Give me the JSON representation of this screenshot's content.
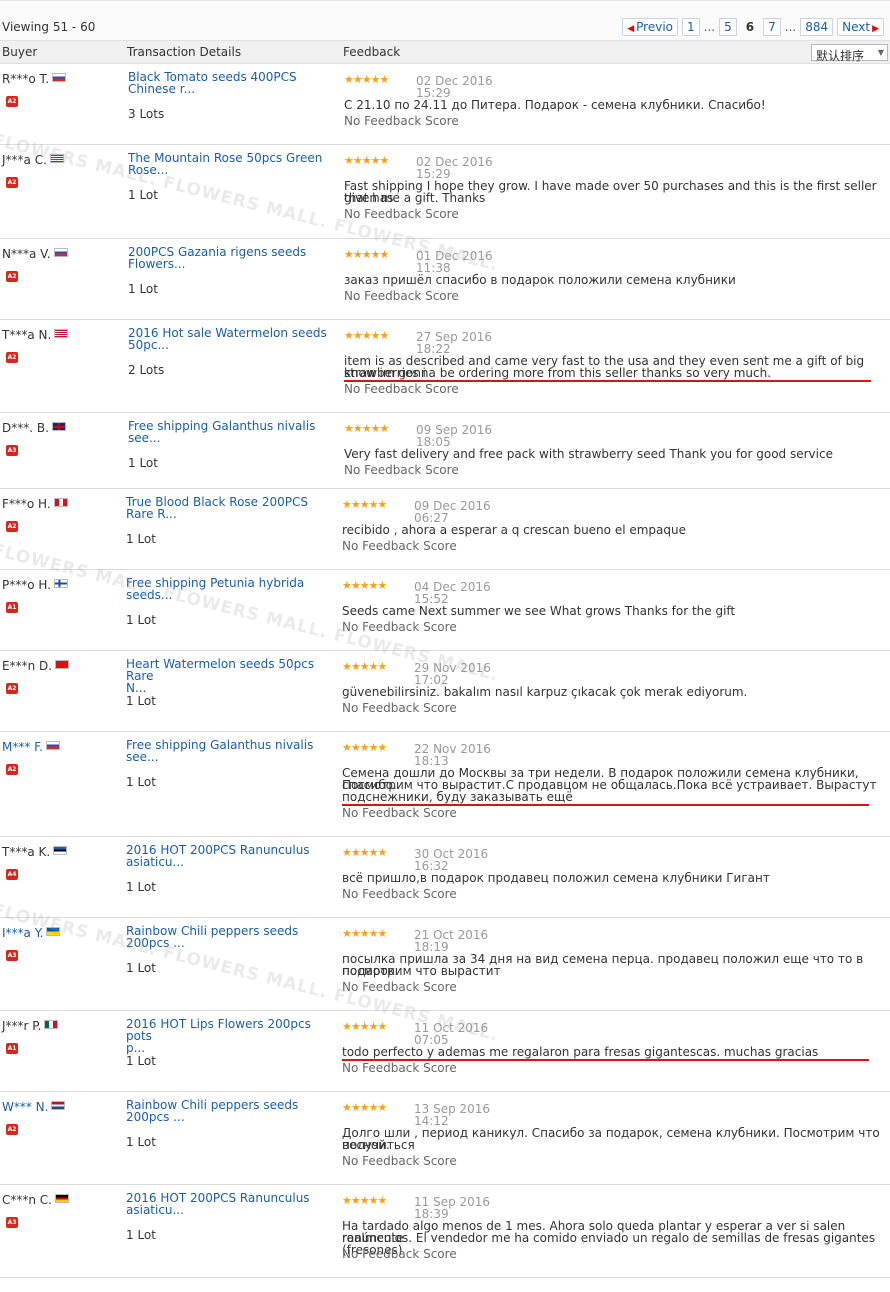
{
  "pagination": {
    "viewing": "Viewing 51 - 60",
    "prev": "Previo",
    "next": "Next",
    "pages": [
      "1",
      "...",
      "5",
      "6",
      "7",
      "...",
      "884"
    ],
    "current": "6"
  },
  "header": {
    "buyer": "Buyer",
    "transaction": "Transaction Details",
    "feedback": "Feedback",
    "sort": "默认排序"
  },
  "watermark_text": "FLOWERS MALL. FLOWERS MALL. FLOWERS MALL.",
  "colors": {
    "link": "#1a5ea8",
    "star": "#f7a11a",
    "badge": "#d9261c",
    "underline": "#e01010"
  },
  "reviews": [
    {
      "buyer": "R***o T.",
      "country": "ru",
      "level": "A2",
      "product": [
        "Black Tomato seeds 400PCS",
        "Chinese r..."
      ],
      "lots": "3 Lots",
      "stars": "★★★★★",
      "date": "02 Dec 2016",
      "time": "15:29",
      "text": [
        "С 21.10 по 24.11 до Питера. Подарок - семена клубники. Спасибо!"
      ],
      "score": "No Feedback Score"
    },
    {
      "buyer": "J***a C.",
      "country": "us",
      "level": "A2",
      "product": [
        "The Mountain Rose 50pcs Green",
        "Rose..."
      ],
      "lots": "1 Lot",
      "stars": "★★★★★",
      "date": "02 Dec 2016",
      "time": "15:29",
      "text": [
        "Fast shipping I hope they grow. I have made over 50 purchases and this is the first seller that has",
        "given me a gift. Thanks"
      ],
      "score": "No Feedback Score"
    },
    {
      "buyer": "N***a V.",
      "country": "ru",
      "level": "A2",
      "product": [
        "200PCS Gazania rigens seeds",
        "Flowers..."
      ],
      "lots": "1 Lot",
      "stars": "★★★★★",
      "date": "01 Dec 2016",
      "time": "11:38",
      "text": [
        "заказ пришёл спасибо в подарок положили семена клубники"
      ],
      "score": "No Feedback Score"
    },
    {
      "buyer": "T***a N.",
      "country": "us",
      "level": "A2",
      "product": [
        "2016 Hot sale Watermelon seeds",
        "50pc..."
      ],
      "lots": "2 Lots",
      "stars": "★★★★★",
      "date": "27 Sep 2016",
      "time": "18:22",
      "text": [
        "item is as described and came very fast to the usa and they even sent me a gift of big strawberries i",
        "know im gonna be ordering more from this seller thanks so very much."
      ],
      "score": "No Feedback Score"
    },
    {
      "buyer": "D***. B.",
      "country": "gb",
      "level": "A3",
      "product": [
        "Free shipping Galanthus nivalis",
        "see..."
      ],
      "lots": "1 Lot",
      "stars": "★★★★★",
      "date": "09 Sep 2016",
      "time": "18:05",
      "text": [
        "Very fast delivery and free pack with strawberry seed Thank you for good service"
      ],
      "score": "No Feedback Score"
    },
    {
      "buyer": "F***o H.",
      "country": "pe",
      "level": "A2",
      "product": [
        "True Blood Black Rose 200PCS",
        "Rare R..."
      ],
      "lots": "1 Lot",
      "stars": "★★★★★",
      "date": "09 Dec 2016",
      "time": "06:27",
      "text": [
        "recibido , ahora a esperar a q crescan bueno el empaque"
      ],
      "score": "No Feedback Score"
    },
    {
      "buyer": "P***o H.",
      "country": "fi",
      "level": "A1",
      "product": [
        "Free shipping Petunia hybrida",
        "seeds..."
      ],
      "lots": "1 Lot",
      "stars": "★★★★★",
      "date": "04 Dec 2016",
      "time": "15:52",
      "text": [
        "Seeds came Next summer we see What grows Thanks for the gift"
      ],
      "score": "No Feedback Score"
    },
    {
      "buyer": "E***n D.",
      "country": "tr",
      "level": "A2",
      "product": [
        "Heart Watermelon seeds 50pcs Rare",
        "N..."
      ],
      "lots": "1 Lot",
      "stars": "★★★★★",
      "date": "29 Nov 2016",
      "time": "17:02",
      "text": [
        "güvenebilirsiniz. bakalım nasıl karpuz çıkacak çok merak ediyorum."
      ],
      "score": "No Feedback Score"
    },
    {
      "buyer": "M*** F.",
      "country": "ru",
      "level": "A2",
      "product": [
        "Free shipping Galanthus nivalis",
        "see..."
      ],
      "lots": "1 Lot",
      "stars": "★★★★★",
      "date": "22 Nov 2016",
      "time": "18:13",
      "text": [
        "Семена дошли до Москвы за три недели. В подарок положили семена клубники, спасибо.",
        "Посмотрим что вырастит.С продавцом не общалась.Пока всё устраивает. Вырастут",
        "подснежники, буду заказывать ещё"
      ],
      "score": "No Feedback Score"
    },
    {
      "buyer": "T***a K.",
      "country": "ee",
      "level": "A4",
      "product": [
        "2016 HOT 200PCS Ranunculus",
        "asiaticu..."
      ],
      "lots": "1 Lot",
      "stars": "★★★★★",
      "date": "30 Oct 2016",
      "time": "16:32",
      "text": [
        "всё пришло,в подарок продавец положил семена клубники Гигант"
      ],
      "score": "No Feedback Score"
    },
    {
      "buyer": "I***a Y.",
      "country": "ua",
      "level": "A3",
      "product": [
        "Rainbow Chili peppers seeds",
        "200pcs ..."
      ],
      "lots": "1 Lot",
      "stars": "★★★★★",
      "date": "21 Oct 2016",
      "time": "18:19",
      "text": [
        "посылка пришла за 34 дня на вид семена перца. продавец положил еще что то в подарок.",
        "посмотрим что вырастит"
      ],
      "score": "No Feedback Score"
    },
    {
      "buyer": "J***r P.",
      "country": "mx",
      "level": "A1",
      "product": [
        "2016 HOT Lips Flowers 200pcs pots",
        "p..."
      ],
      "lots": "1 Lot",
      "stars": "★★★★★",
      "date": "11 Oct 2016",
      "time": "07:05",
      "text": [
        "todo perfecto y ademas me regalaron para fresas gigantescas. muchas gracias"
      ],
      "score": "No Feedback Score"
    },
    {
      "buyer": "W*** N.",
      "country": "nl",
      "level": "A2",
      "product": [
        "Rainbow Chili peppers seeds",
        "200pcs ..."
      ],
      "lots": "1 Lot",
      "stars": "★★★★★",
      "date": "13 Sep 2016",
      "time": "14:12",
      "text": [
        "Долго шли , период каникул. Спасибо за подарок, семена клубники. Посмотрим что получиться",
        "весной."
      ],
      "score": "No Feedback Score"
    },
    {
      "buyer": "C***n C.",
      "country": "de",
      "level": "A3",
      "product": [
        "2016 HOT 200PCS Ranunculus",
        "asiaticu..."
      ],
      "lots": "1 Lot",
      "stars": "★★★★★",
      "date": "11 Sep 2016",
      "time": "18:39",
      "text": [
        "Ha tardado algo menos de 1 mes. Ahora solo queda plantar y esperar a ver si salen realmente",
        "ranúnculos. El vendedor me ha comido enviado un regalo de semillas de fresas gigantes (fresones)"
      ],
      "score": "No Feedback Score"
    }
  ]
}
